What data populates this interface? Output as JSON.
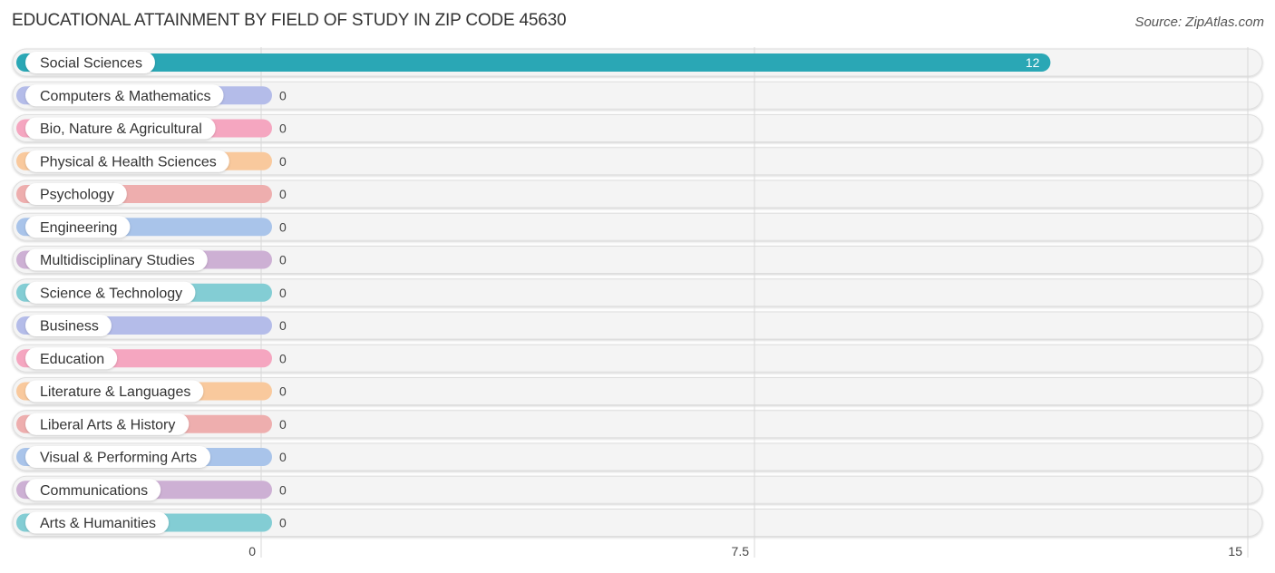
{
  "header": {
    "title": "EDUCATIONAL ATTAINMENT BY FIELD OF STUDY IN ZIP CODE 45630",
    "source": "Source: ZipAtlas.com"
  },
  "chart_data": {
    "type": "bar",
    "orientation": "horizontal",
    "title": "EDUCATIONAL ATTAINMENT BY FIELD OF STUDY IN ZIP CODE 45630",
    "xlabel": "",
    "ylabel": "",
    "xlim": [
      0,
      15
    ],
    "ticks": [
      0,
      7.5,
      15
    ],
    "tick_labels": [
      "0",
      "7.5",
      "15"
    ],
    "grid": true,
    "categories": [
      "Social Sciences",
      "Computers & Mathematics",
      "Bio, Nature & Agricultural",
      "Physical & Health Sciences",
      "Psychology",
      "Engineering",
      "Multidisciplinary Studies",
      "Science & Technology",
      "Business",
      "Education",
      "Literature & Languages",
      "Liberal Arts & History",
      "Visual & Performing Arts",
      "Communications",
      "Arts & Humanities"
    ],
    "values": [
      12,
      0,
      0,
      0,
      0,
      0,
      0,
      0,
      0,
      0,
      0,
      0,
      0,
      0,
      0
    ],
    "value_labels": [
      "12",
      "0",
      "0",
      "0",
      "0",
      "0",
      "0",
      "0",
      "0",
      "0",
      "0",
      "0",
      "0",
      "0",
      "0"
    ],
    "colors": [
      "#2aa7b5",
      "#b4bce9",
      "#f5a6c0",
      "#f9c99d",
      "#eeaeae",
      "#a9c4ea",
      "#cdb0d4",
      "#83cdd4",
      "#b4bce9",
      "#f5a6c0",
      "#f9c99d",
      "#eeaeae",
      "#a9c4ea",
      "#cdb0d4",
      "#83cdd4"
    ]
  }
}
